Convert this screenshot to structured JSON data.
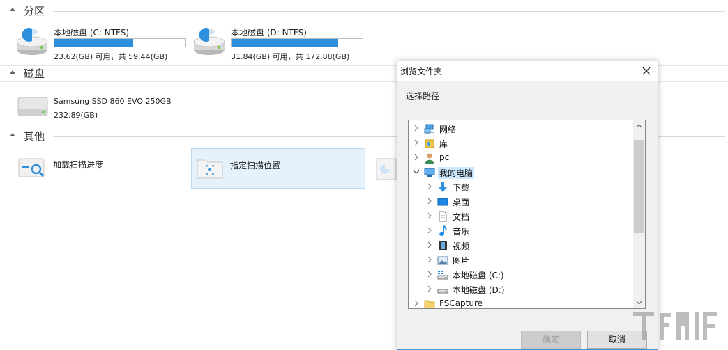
{
  "sections": {
    "partitions": "分区",
    "disks": "磁盘",
    "other": "其他"
  },
  "partitions": [
    {
      "name": "本地磁盘 (C: NTFS)",
      "info": "23.62(GB) 可用，共 59.44(GB)",
      "used_fraction": 0.6
    },
    {
      "name": "本地磁盘 (D: NTFS)",
      "info": "31.84(GB) 可用，共 172.88(GB)",
      "used_fraction": 0.81
    }
  ],
  "disks": [
    {
      "name": "Samsung SSD 860 EVO 250GB",
      "size": "232.89(GB)"
    }
  ],
  "other": {
    "load_scan": "加载扫描进度",
    "specify_scan": "指定扫描位置"
  },
  "dialog": {
    "title": "浏览文件夹",
    "prompt": "选择路径",
    "ok": "确定",
    "cancel": "取消",
    "tree": [
      {
        "label": "网络",
        "icon": "network-icon"
      },
      {
        "label": "库",
        "icon": "library-icon"
      },
      {
        "label": "pc",
        "icon": "user-icon"
      },
      {
        "label": "我的电脑",
        "icon": "computer-icon",
        "expanded": true,
        "selected": true
      },
      {
        "label": "下载",
        "icon": "download-icon"
      },
      {
        "label": "桌面",
        "icon": "desktop-icon"
      },
      {
        "label": "文档",
        "icon": "document-icon"
      },
      {
        "label": "音乐",
        "icon": "music-icon"
      },
      {
        "label": "视频",
        "icon": "video-icon"
      },
      {
        "label": "图片",
        "icon": "picture-icon"
      },
      {
        "label": "本地磁盘 (C:)",
        "icon": "drive-c-icon"
      },
      {
        "label": "本地磁盘 (D:)",
        "icon": "drive-d-icon"
      },
      {
        "label": "FSCapture",
        "icon": "folder-icon"
      }
    ]
  },
  "colors": {
    "accent": "#2e8fdc",
    "selection": "#cce8ff",
    "tile_active": "#e5f1fb"
  }
}
